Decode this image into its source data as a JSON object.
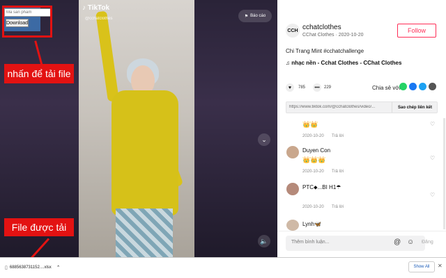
{
  "downloader": {
    "input_placeholder": "Ma san pham",
    "button_label": "Download"
  },
  "annotations": {
    "click_label": "nhấn để tải file",
    "file_label": "File được tải"
  },
  "video": {
    "logo": "♪ TikTok",
    "handle": "@cchatclothes",
    "report_label": "Báo cáo"
  },
  "post": {
    "avatar_text": "CCH",
    "username": "cchatclothes",
    "subname": "CChat Clothes · 2020-10-20",
    "follow_label": "Follow",
    "caption": "Chi Trang Mint #cchatchallenge",
    "music": "♫  nhạc nền - Cchat Clothes - CChat Clothes",
    "likes": "785",
    "comments": "229",
    "share_label": "Chia sẻ với",
    "link": "https://www.tiktok.com/@cchatclothes/video/...",
    "copy_label": "Sao chép liên kết"
  },
  "comments": [
    {
      "text": "👑👑",
      "date": "2020-10-20",
      "reply": "Trả lời"
    },
    {
      "name": "Duyen Con",
      "text": "👑👑👑",
      "date": "2020-10-20",
      "reply": "Trả lời"
    },
    {
      "name": "PTC⬥...BI H1☂",
      "date": "2020-10-20",
      "reply": "Trả lời"
    },
    {
      "name": "Lynh🦋"
    }
  ],
  "comment_input": {
    "placeholder": "Thêm bình luận...",
    "post_label": "Đăng"
  },
  "download_bar": {
    "file_name": "6885638731152....xlsx",
    "show_all": "Show All"
  },
  "colors": {
    "annotation": "#e31212",
    "follow": "#fe2c55"
  }
}
